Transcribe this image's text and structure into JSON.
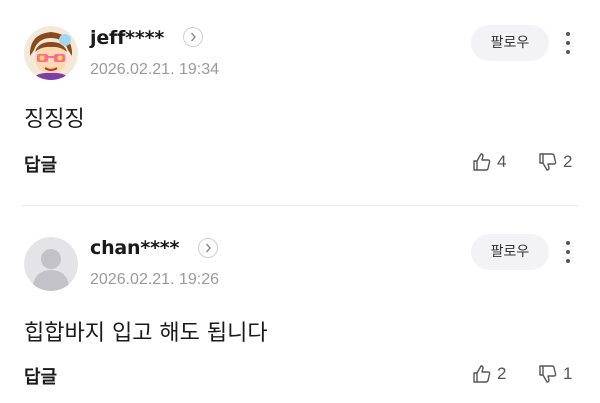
{
  "comments": [
    {
      "username": "jeff****",
      "date": "2026.02.21. 19:34",
      "follow_label": "팔로우",
      "text": "징징징",
      "reply_label": "답글",
      "likes": "4",
      "dislikes": "2"
    },
    {
      "username": "chan****",
      "date": "2026.02.21. 19:26",
      "follow_label": "팔로우",
      "text": "힙합바지 입고 해도 됩니다",
      "reply_label": "답글",
      "likes": "2",
      "dislikes": "1"
    }
  ],
  "icons": {
    "profile_link": "chevron-right-icon",
    "more": "more-vertical-icon",
    "like": "thumbs-up-icon",
    "dislike": "thumbs-down-icon",
    "avatar_default": "default-avatar-icon"
  },
  "colors": {
    "text": "#1a1a1a",
    "meta": "#9a9a9a",
    "button_bg": "#f3f3f5",
    "divider": "#ececec"
  }
}
